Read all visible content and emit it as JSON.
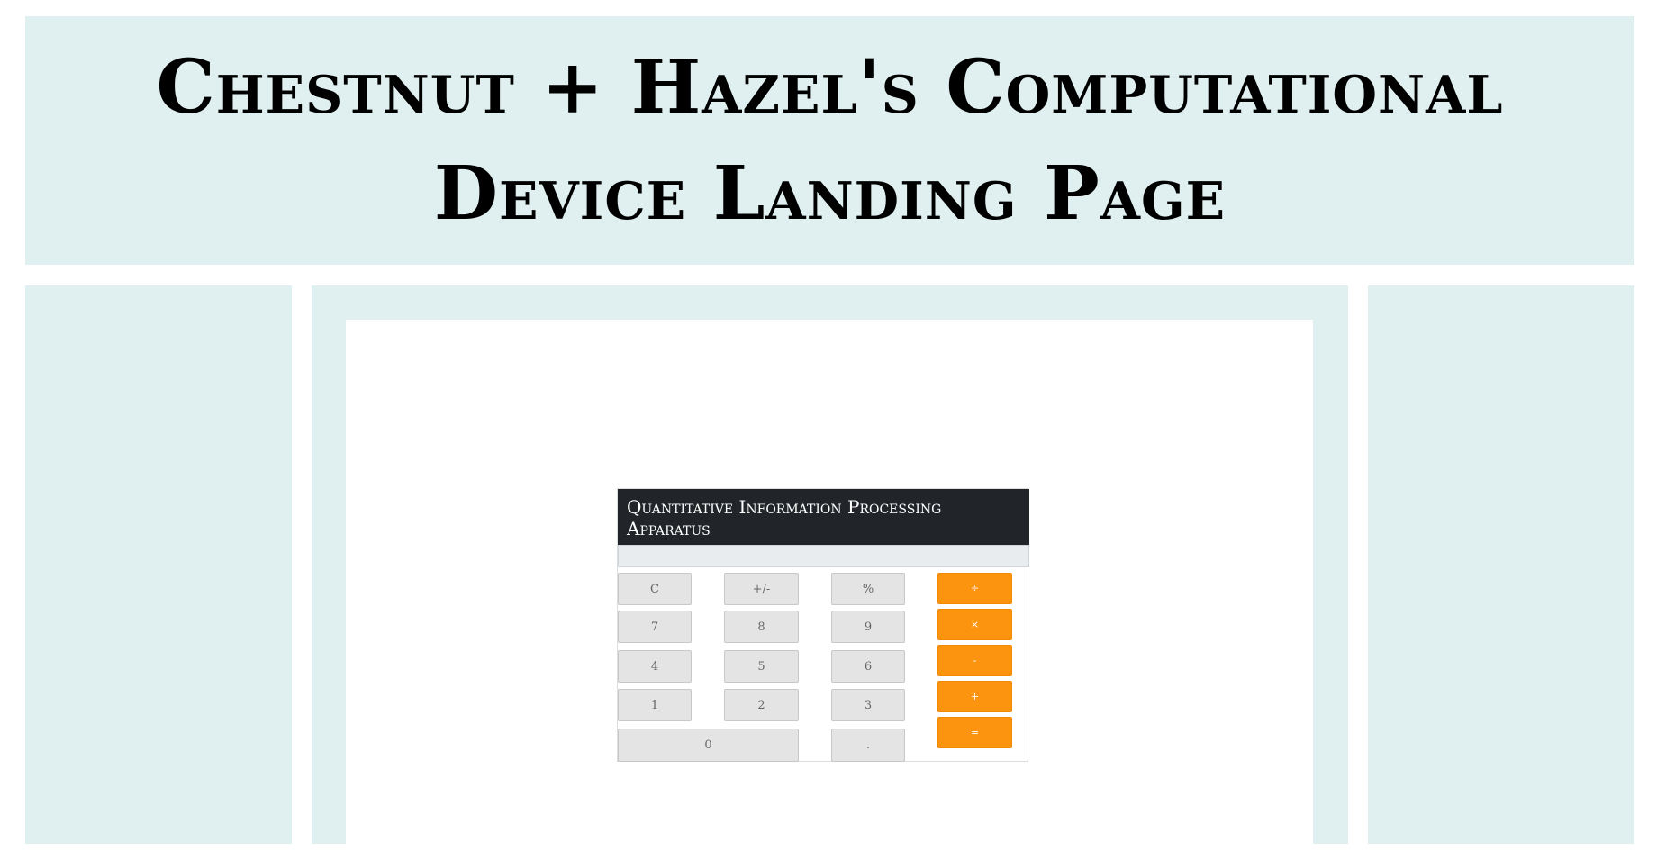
{
  "header": {
    "title": "Chestnut + Hazel's Computational Device Landing Page"
  },
  "calculator": {
    "title": "Quantitative Information Processing Apparatus",
    "display": "",
    "keys": {
      "clear": "C",
      "sign": "+/-",
      "percent": "%",
      "divide": "÷",
      "seven": "7",
      "eight": "8",
      "nine": "9",
      "multiply": "×",
      "four": "4",
      "five": "5",
      "six": "6",
      "subtract": "-",
      "one": "1",
      "two": "2",
      "three": "3",
      "add": "+",
      "zero": "0",
      "decimal": ".",
      "equals": "="
    }
  },
  "colors": {
    "background_panel": "#e0efef",
    "calc_header": "#212529",
    "key_gray": "#e4e4e4",
    "key_orange": "#fd9410"
  }
}
